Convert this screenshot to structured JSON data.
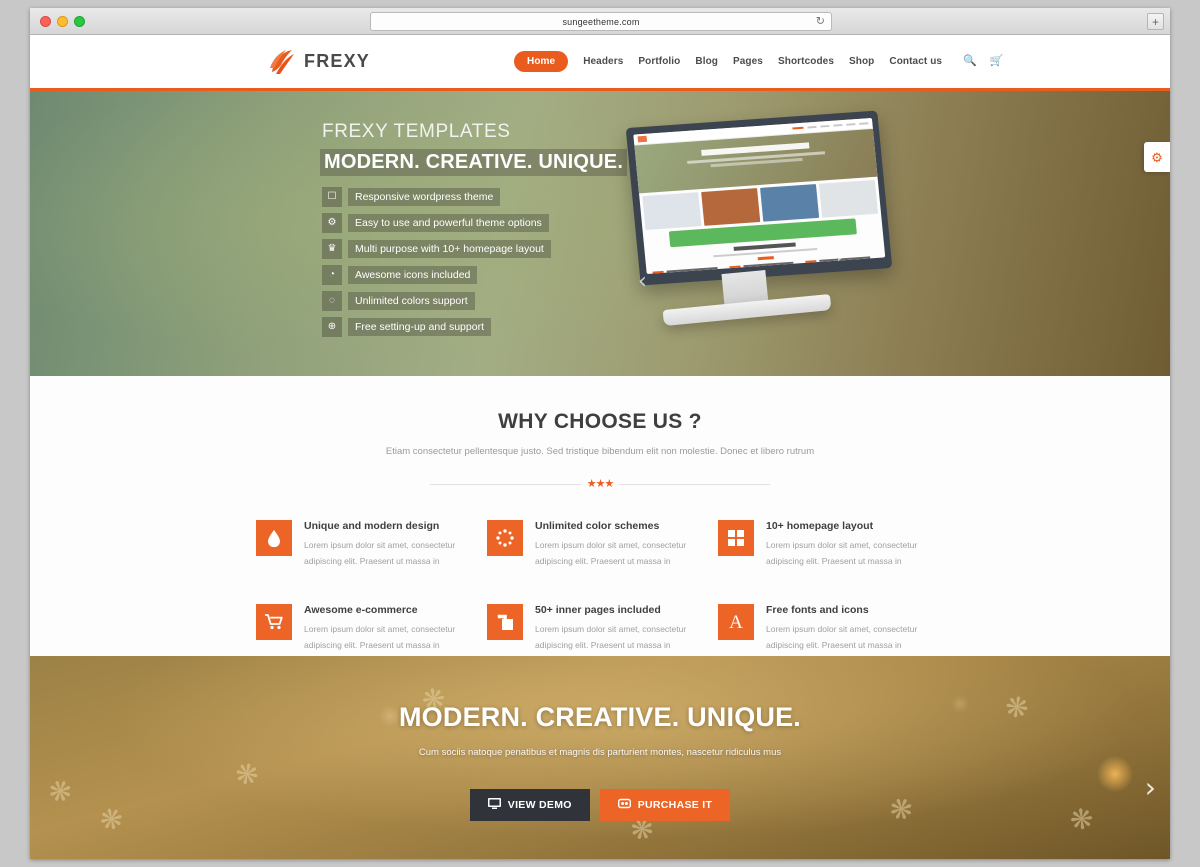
{
  "browser": {
    "url": "sungeetheme.com",
    "reload_icon": "reload-icon",
    "new_tab_label": "+",
    "traffic_lights": [
      "close",
      "minimize",
      "zoom"
    ]
  },
  "header": {
    "logo_text": "FREXY",
    "logo_icon": "frexy-swoosh-logo",
    "nav": [
      {
        "label": "Home",
        "active": true
      },
      {
        "label": "Headers",
        "active": false
      },
      {
        "label": "Portfolio",
        "active": false
      },
      {
        "label": "Blog",
        "active": false
      },
      {
        "label": "Pages",
        "active": false
      },
      {
        "label": "Shortcodes",
        "active": false
      },
      {
        "label": "Shop",
        "active": false
      },
      {
        "label": "Contact us",
        "active": false
      }
    ],
    "search_icon": "search-icon",
    "cart_icon": "cart-icon"
  },
  "hero": {
    "title": "FREXY TEMPLATES",
    "subtitle": "MODERN. CREATIVE. UNIQUE.",
    "items": [
      {
        "icon": "mobile-icon",
        "glyph": "☐",
        "label": "Responsive wordpress theme"
      },
      {
        "icon": "gear-icon",
        "glyph": "⚙",
        "label": "Easy to use and powerful theme options"
      },
      {
        "icon": "trophy-icon",
        "glyph": "♛",
        "label": "Multi purpose with 10+ homepage layout"
      },
      {
        "icon": "globe-icon",
        "glyph": "◔",
        "label": "Awesome icons included"
      },
      {
        "icon": "color-circles-icon",
        "glyph": "◌",
        "label": "Unlimited colors support"
      },
      {
        "icon": "support-icon",
        "glyph": "⊕",
        "label": "Free setting-up and support"
      }
    ],
    "monitor_headline": "AWESOME PSD TEMPLATE",
    "prev_arrow": "‹",
    "next_arrow": "›",
    "settings_icon": "gears-settings-icon",
    "settings_glyph": "⚙"
  },
  "why": {
    "heading": "WHY CHOOSE US ?",
    "subtitle": "Etiam consectetur pellentesque justo. Sed tristique bibendum elit non molestie. Donec et libero rutrum",
    "divider_stars": "★★★",
    "features": [
      {
        "icon": "droplet-icon",
        "glyph": "●",
        "title": "Unique and modern design",
        "text": "Lorem ipsum dolor sit amet, consectetur adipiscing elit. Praesent ut massa in"
      },
      {
        "icon": "color-circles-icon",
        "glyph": "◌",
        "title": "Unlimited color schemes",
        "text": "Lorem ipsum dolor sit amet, consectetur adipiscing elit. Praesent ut massa in"
      },
      {
        "icon": "grid-layout-icon",
        "glyph": "▦",
        "title": "10+ homepage layout",
        "text": "Lorem ipsum dolor sit amet, consectetur adipiscing elit. Praesent ut massa in"
      },
      {
        "icon": "shopping-cart-icon",
        "glyph": "Ὥ2",
        "title": "Awesome e-commerce",
        "text": "Lorem ipsum dolor sit amet, consectetur adipiscing elit. Praesent ut massa in"
      },
      {
        "icon": "pages-copy-icon",
        "glyph": "❐",
        "title": "50+ inner pages included",
        "text": "Lorem ipsum dolor sit amet, consectetur adipiscing elit. Praesent ut massa in"
      },
      {
        "icon": "font-letter-a-icon",
        "glyph": "A",
        "title": "Free fonts and icons",
        "text": "Lorem ipsum dolor sit amet, consectetur adipiscing elit. Praesent ut massa in"
      }
    ]
  },
  "cta": {
    "heading": "MODERN. CREATIVE. UNIQUE.",
    "tagline": "Cum sociis natoque penatibus et magnis dis parturient montes, nascetur ridiculus mus",
    "demo_button": "VIEW DEMO",
    "demo_icon": "monitor-icon",
    "demo_glyph": "☐",
    "purchase_button": "PURCHASE IT",
    "purchase_icon": "purchase-icon",
    "purchase_glyph": "⧉",
    "next_arrow": "›"
  },
  "colors": {
    "accent": "#ea5c1e",
    "accent_tile": "#ec6426",
    "dark_button": "#30343a",
    "heading": "#3f3f3f",
    "muted_text": "#a0a0a0"
  }
}
